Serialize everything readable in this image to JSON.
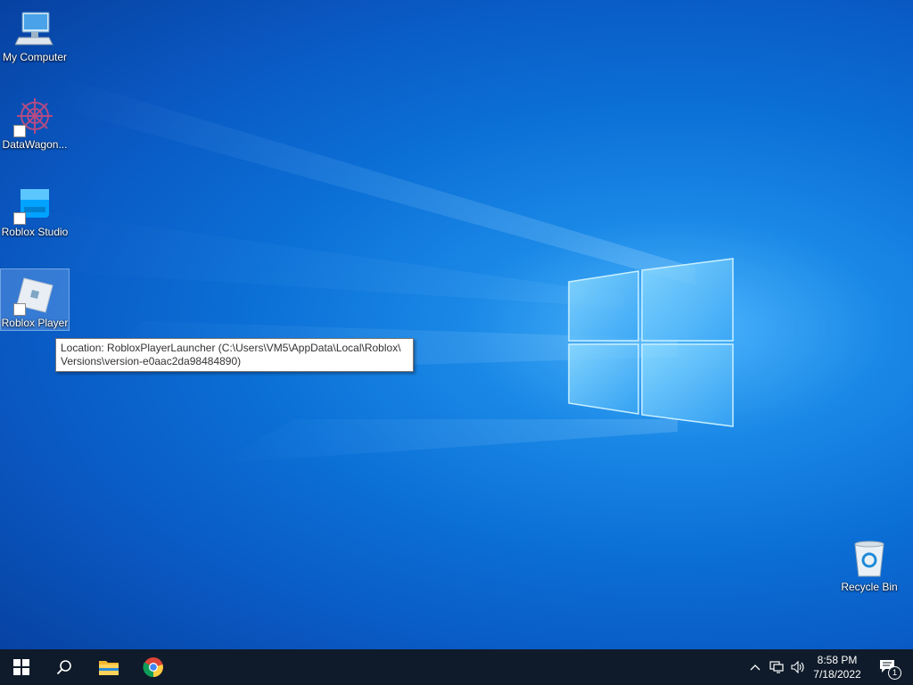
{
  "desktop": {
    "icons": [
      {
        "label": "My Computer"
      },
      {
        "label": "DataWagon..."
      },
      {
        "label": "Roblox Studio"
      },
      {
        "label": "Roblox Player"
      },
      {
        "label": "Recycle Bin"
      }
    ],
    "tooltip": {
      "line1": "Location: RobloxPlayerLauncher (C:\\Users\\VM5\\AppData\\Local\\Roblox\\",
      "line2": "Versions\\version-e0aac2da98484890)"
    }
  },
  "taskbar": {
    "time": "8:58 PM",
    "date": "7/18/2022",
    "notification_count": "1"
  },
  "colors": {
    "taskbar_bg": "#0f1b2a",
    "desktop_accent": "#0a6fd6"
  }
}
